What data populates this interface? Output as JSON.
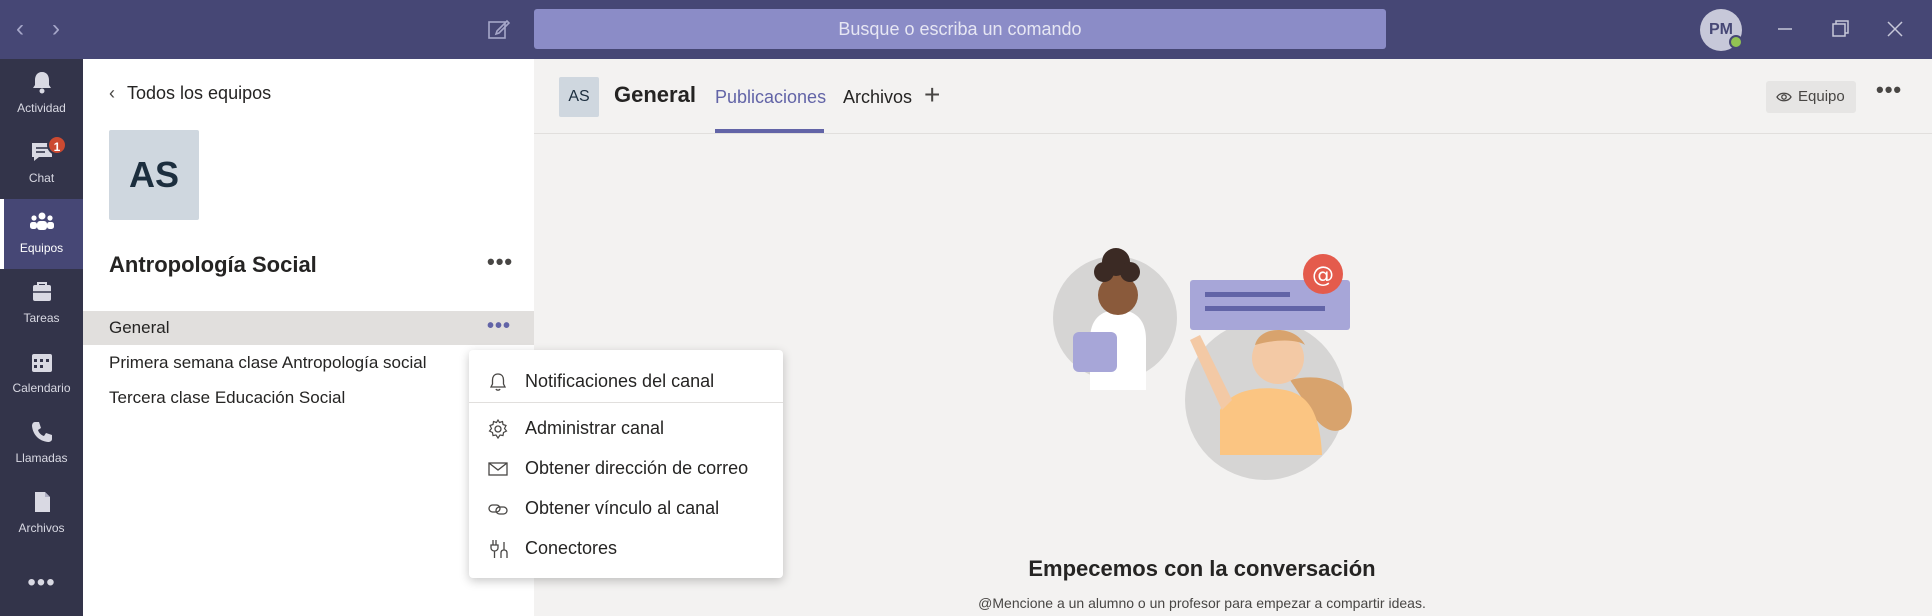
{
  "titlebar": {
    "search_placeholder": "Busque o escriba un comando",
    "user_initials": "PM"
  },
  "rail": {
    "items": [
      {
        "label": "Actividad"
      },
      {
        "label": "Chat",
        "badge": "1"
      },
      {
        "label": "Equipos"
      },
      {
        "label": "Tareas"
      },
      {
        "label": "Calendario"
      },
      {
        "label": "Llamadas"
      },
      {
        "label": "Archivos"
      }
    ],
    "more": "•••"
  },
  "team": {
    "back_label": "Todos los equipos",
    "initials": "AS",
    "name": "Antropología Social",
    "more": "•••",
    "channels": [
      {
        "name": "General"
      },
      {
        "name": "Primera semana clase Antropología social"
      },
      {
        "name": "Tercera clase Educación Social"
      }
    ],
    "channel_more": "•••"
  },
  "main": {
    "channel_initials": "AS",
    "channel_title": "General",
    "tabs": [
      {
        "label": "Publicaciones"
      },
      {
        "label": "Archivos"
      }
    ],
    "tab_add": "+",
    "team_button": "Equipo",
    "more": "•••",
    "empty_title": "Empecemos con la conversación",
    "empty_subtitle": "@Mencione a un alumno o un profesor para empezar a compartir ideas."
  },
  "menu": {
    "items": [
      {
        "label": "Notificaciones del canal"
      },
      {
        "label": "Administrar canal"
      },
      {
        "label": "Obtener dirección de correo"
      },
      {
        "label": "Obtener vínculo al canal"
      },
      {
        "label": "Conectores"
      }
    ]
  },
  "colors": {
    "titlebar": "#464775",
    "rail": "#33344a",
    "accent": "#6264a7",
    "badge": "#cc4a31"
  }
}
